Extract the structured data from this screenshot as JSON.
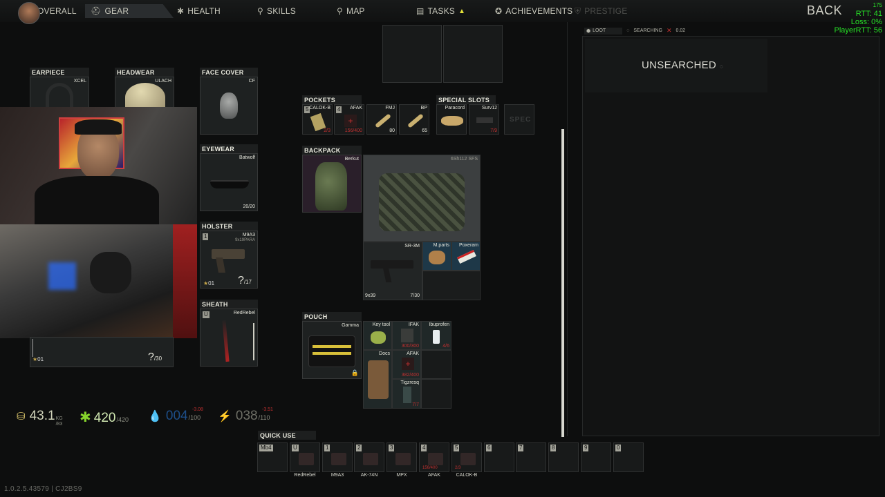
{
  "topbar": {
    "tabs": [
      {
        "label": "OVERALL",
        "icon": "overall-avatar-icon"
      },
      {
        "label": "GEAR",
        "icon": "gear-helmet-icon"
      },
      {
        "label": "HEALTH",
        "icon": "health-star-icon"
      },
      {
        "label": "SKILLS",
        "icon": "skills-pin-icon"
      },
      {
        "label": "MAP",
        "icon": "map-pin-icon"
      },
      {
        "label": "TASKS",
        "icon": "tasks-clipboard-icon"
      },
      {
        "label": "ACHIEVEMENTS",
        "icon": "achievements-star-icon"
      },
      {
        "label": "PRESTIGE",
        "icon": "prestige-shield-icon"
      }
    ],
    "back_label": "BACK",
    "active_tab": "GEAR"
  },
  "network": {
    "fps": "175",
    "rtt": "RTT: 41",
    "loss": "Loss: 0%",
    "player_rtt": "PlayerRTT: 56"
  },
  "equipment": {
    "earpiece": {
      "title": "EARPIECE",
      "item": "XCEL"
    },
    "headwear": {
      "title": "HEADWEAR",
      "item": "ULACH"
    },
    "face_cover": {
      "title": "FACE COVER",
      "item": "CF"
    },
    "eyewear": {
      "title": "EYEWEAR",
      "item": "Batwolf",
      "count": "20/20"
    },
    "holster": {
      "title": "HOLSTER",
      "item": "M9A3",
      "ammo": "9x19PARA",
      "slot": "1",
      "mag": "?",
      "mag_max": "/17",
      "level": "01"
    },
    "sheath": {
      "title": "SHEATH",
      "item": "RedRebel",
      "slot": "U"
    },
    "weapon_partial": {
      "mag": "?",
      "mag_max": "/30",
      "level": "01"
    }
  },
  "pockets": {
    "title": "POCKETS",
    "items": [
      {
        "slot": "5",
        "name": "CALOK-B",
        "count": "2/3"
      },
      {
        "slot": "4",
        "name": "AFAK",
        "count": "156/400"
      },
      {
        "slot": "",
        "name": "FMJ",
        "count": "80"
      },
      {
        "slot": "",
        "name": "BP",
        "count": "65"
      }
    ]
  },
  "special_slots": {
    "title": "SPECIAL SLOTS",
    "items": [
      {
        "name": "Paracord",
        "count": ""
      },
      {
        "name": "Surv12",
        "count": "7/9"
      },
      {
        "name": "SPEC",
        "count": ""
      }
    ]
  },
  "backpack": {
    "title": "BACKPACK",
    "item": "Berkut",
    "rig_item": "6Sh112 SFS",
    "contents": [
      {
        "name": "SR-3M",
        "caliber": "9x39",
        "count": "7/30"
      },
      {
        "name": "M.parts",
        "count": ""
      },
      {
        "name": "Poxeram",
        "count": ""
      }
    ]
  },
  "pouch": {
    "title": "POUCH",
    "item": "Gamma",
    "contents": [
      {
        "name": "Key tool",
        "count": ""
      },
      {
        "name": "IFAK",
        "count": "300/300"
      },
      {
        "name": "Ibuprofen",
        "count": "4/6"
      },
      {
        "name": "Docs",
        "count": ""
      },
      {
        "name": "AFAK",
        "count": "382/400"
      },
      {
        "name": "Tigzresq",
        "count": "7/7"
      }
    ]
  },
  "stats": {
    "weight": {
      "value": "43.1",
      "unit": "KG",
      "max": "/83"
    },
    "health": {
      "value": "420",
      "max": "/420"
    },
    "hydration": {
      "value": "004",
      "max": "/100",
      "delta": "-3.08"
    },
    "energy": {
      "value": "038",
      "max": "/110",
      "delta": "-3.51"
    }
  },
  "quick_use": {
    "title": "QUICK USE",
    "slots": [
      {
        "num": "Mb4",
        "label": ""
      },
      {
        "num": "U",
        "label": "RedRebel"
      },
      {
        "num": "1",
        "label": "M9A3"
      },
      {
        "num": "2",
        "label": "AK-74N"
      },
      {
        "num": "3",
        "label": "MPX"
      },
      {
        "num": "4",
        "label": "AFAK",
        "count": "156/400"
      },
      {
        "num": "5",
        "label": "CALOK-B",
        "count": "2/3"
      },
      {
        "num": "6",
        "label": ""
      },
      {
        "num": "7",
        "label": ""
      },
      {
        "num": "8",
        "label": ""
      },
      {
        "num": "9",
        "label": ""
      },
      {
        "num": "0",
        "label": ""
      }
    ]
  },
  "loot": {
    "tab_label": "LOOT",
    "status": "SEARCHING",
    "timer": "0.02",
    "state": "UNSEARCHED"
  },
  "version": "1.0.2.5.43579 | CJ2BS9",
  "colors": {
    "accent_green": "#27e227",
    "health_green": "#86d42c",
    "hydration_blue": "#2e7fd8",
    "damage_red": "#c23030",
    "warning_yellow": "#e6e43a"
  }
}
